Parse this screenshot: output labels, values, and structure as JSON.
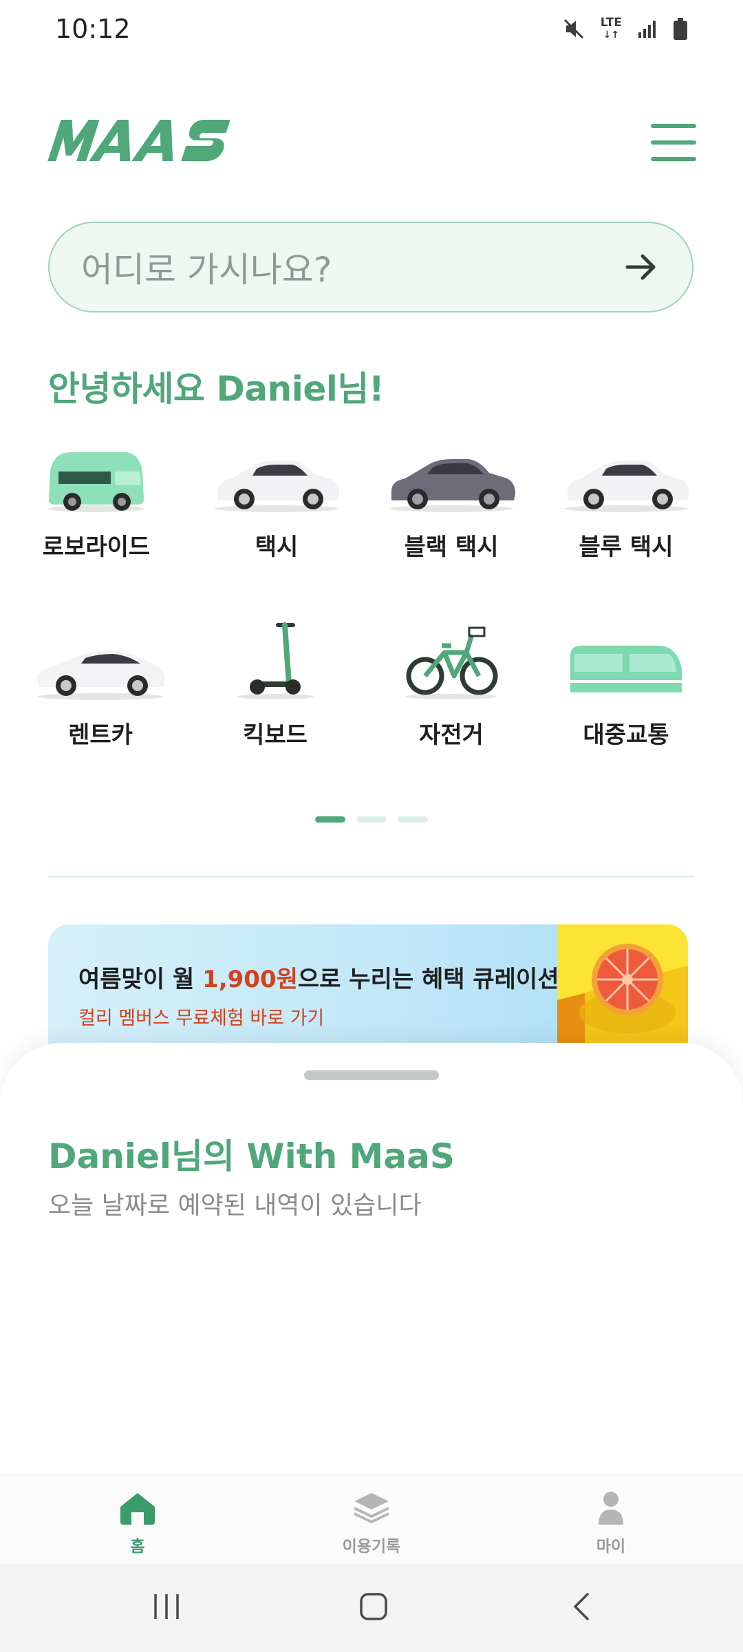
{
  "status_bar": {
    "time": "10:12",
    "network": "LTE"
  },
  "header": {
    "logo_text": "MAAS"
  },
  "search": {
    "placeholder": "어디로 가시나요?"
  },
  "greeting": "안녕하세요 Daniel님!",
  "modes": [
    {
      "label": "로보라이드",
      "icon": "robo-van-icon"
    },
    {
      "label": "택시",
      "icon": "taxi-icon"
    },
    {
      "label": "블랙 택시",
      "icon": "black-taxi-icon"
    },
    {
      "label": "블루 택시",
      "icon": "blue-taxi-icon"
    },
    {
      "label": "렌트카",
      "icon": "rent-car-icon"
    },
    {
      "label": "킥보드",
      "icon": "kickboard-icon"
    },
    {
      "label": "자전거",
      "icon": "bicycle-icon"
    },
    {
      "label": "대중교통",
      "icon": "public-transit-icon"
    }
  ],
  "pagination": {
    "pages": 3,
    "active": 0
  },
  "banner": {
    "title_before": "여름맞이 월 ",
    "title_highlight": "1,900원",
    "title_after": "으로 누리는 혜택 큐레이션",
    "subtitle": "컬리 멤버스 무료체험 바로 가기"
  },
  "sheet": {
    "title": "Daniel님의 With MaaS",
    "subtitle": "오늘 날짜로 예약된 내역이 있습니다"
  },
  "bottom_nav": [
    {
      "label": "홈",
      "icon": "home-icon",
      "active": true
    },
    {
      "label": "이용기록",
      "icon": "layers-icon",
      "active": false
    },
    {
      "label": "마이",
      "icon": "person-icon",
      "active": false
    }
  ],
  "colors": {
    "brand": "#4fa77a",
    "accent": "#d1421e"
  }
}
